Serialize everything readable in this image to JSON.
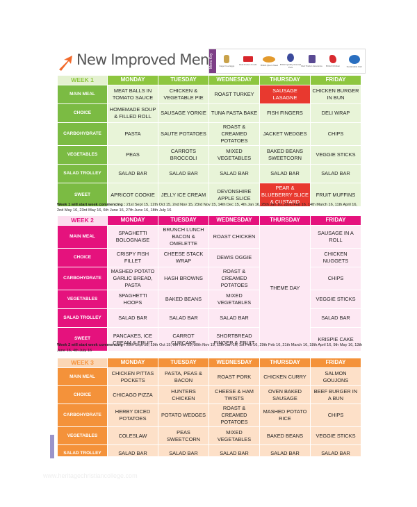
{
  "header": {
    "title": "New Improved Menus",
    "logo_tab": "Menu Key",
    "logos": [
      {
        "name": "Cage Free Eggs",
        "color": "#c9a24a"
      },
      {
        "name": "Real Frozen Foods",
        "color": "#d8262b"
      },
      {
        "name": "British Quorn Meat",
        "color": "#e39a2d"
      },
      {
        "name": "British Quality Assured Pork",
        "color": "#3b4a9c"
      },
      {
        "name": "Red Tractor Assurance",
        "color": "#5a4a93"
      },
      {
        "name": "British Chicken",
        "color": "#d82a2f"
      },
      {
        "name": "Sustainable Fish",
        "color": "#2a6fc0"
      }
    ]
  },
  "days": [
    "MONDAY",
    "TUESDAY",
    "WEDNESDAY",
    "THURSDAY",
    "FRIDAY"
  ],
  "weeks": [
    {
      "label": "WEEK 1",
      "rows": [
        {
          "label": "MAIN MEAL",
          "cells": [
            "MEAT BALLS IN TOMATO SAUCE",
            "CHICKEN & VEGETABLE PIE",
            "ROAST TURKEY",
            "SAUSAGE LASAGNE",
            "CHICKEN BURGER IN BUN"
          ]
        },
        {
          "label": "CHOICE",
          "cells": [
            "HOMEMADE SOUP & FILLED ROLL",
            "SAUSAGE YORKIE",
            "TUNA PASTA BAKE",
            "FISH FINGERS",
            "DELI WRAP"
          ]
        },
        {
          "label": "CARBOHYDRATE",
          "cells": [
            "PASTA",
            "SAUTE POTATOES",
            "ROAST & CREAMED POTATOES",
            "JACKET WEDGES",
            "CHIPS"
          ]
        },
        {
          "label": "VEGETABLES",
          "cells": [
            "PEAS",
            "CARROTS BROCCOLI",
            "MIXED VEGETABLES",
            "BAKED BEANS SWEETCORN",
            "VEGGIE STICKS"
          ]
        },
        {
          "label": "SALAD TROLLEY",
          "cells": [
            "SALAD BAR",
            "SALAD BAR",
            "SALAD BAR",
            "SALAD BAR",
            "SALAD BAR"
          ]
        },
        {
          "label": "SWEET",
          "cells": [
            "APRICOT COOKIE",
            "JELLY ICE CREAM",
            "DEVONSHIRE APPLE SLICE",
            "PEAR & BLUEBERRY SLICE & CUSTARD",
            "FRUIT MUFFINS"
          ]
        }
      ],
      "note_label": "Week 1 will start week commencing :",
      "note_dates": "21st Sept 15, 12th Oct 15, 2nd Nov 15, 23rd Nov 15, 14th Dec 15, 4th Jan 16, 25th Jan 16, 22nd Feb 16, 14th March 16, 11th April 16, 2nd May 16, 23rd May 16, 6th June 16, 27th June 16, 18th July 16"
    },
    {
      "label": "WEEK 2",
      "rows": [
        {
          "label": "MAIN MEAL",
          "cells": [
            "SPAGHETTI BOLOGNAISE",
            "BRUNCH LUNCH BACON & OMELETTE",
            "ROAST CHICKEN",
            "",
            "SAUSAGE IN A ROLL"
          ]
        },
        {
          "label": "CHOICE",
          "cells": [
            "CRISPY FISH FILLET",
            "CHEESE STACK WRAP",
            "DEWIS OGGIE",
            "",
            "CHICKEN NUGGETS"
          ]
        },
        {
          "label": "CARBOHYDRATE",
          "cells": [
            "MASHED POTATO GARLIC BREAD, PASTA",
            "HASH BROWNS",
            "ROAST & CREAMED POTATOES",
            "",
            "CHIPS"
          ]
        },
        {
          "label": "VEGETABLES",
          "cells": [
            "SPAGHETTI HOOPS",
            "BAKED BEANS",
            "MIXED VEGETABLES",
            "THEME DAY",
            "VEGGIE STICKS"
          ]
        },
        {
          "label": "SALAD TROLLEY",
          "cells": [
            "SALAD BAR",
            "SALAD BAR",
            "SALAD BAR",
            "",
            "SALAD BAR"
          ]
        },
        {
          "label": "SWEET",
          "cells": [
            "PANCAKES, ICE CREAM & FRUIT",
            "CARROT CUPCAKE",
            "SHORTBREAD FINGER & FRUIT",
            "",
            "KRISPIE CAKE"
          ]
        }
      ],
      "note_label": "Week 2 will start week commencing :",
      "note_dates": "28th Sept 15, 19th Oct 15, 9th Nov 15, 30th Nov 15, 11th Jan 16, 1st Feb 16, 29th Feb 16, 21th March 16, 18th April 16, 9th May 16, 13th June 16, 4th July 16"
    },
    {
      "label": "WEEK 3",
      "rows": [
        {
          "label": "MAIN MEAL",
          "cells": [
            "CHICKEN PITTAS POCKETS",
            "PASTA, PEAS & BACON",
            "ROAST PORK",
            "CHICKEN CURRY",
            "SALMON GOUJONS"
          ]
        },
        {
          "label": "CHOICE",
          "cells": [
            "CHICAGO PIZZA",
            "HUNTERS CHICKEN",
            "CHEESE & HAM TWISTS",
            "OVEN BAKED SAUSAGE",
            "BEEF BURGER IN A BUN"
          ]
        },
        {
          "label": "CARBOHYDRATE",
          "cells": [
            "HERBY DICED POTATOES",
            "POTATO WEDGES",
            "ROAST & CREAMED POTATOES",
            "MASHED POTATO RICE",
            "CHIPS"
          ]
        },
        {
          "label": "VEGETABLES",
          "cells": [
            "COLESLAW",
            "PEAS SWEETCORN",
            "MIXED VEGETABLES",
            "BAKED BEANS",
            "VEGGIE STICKS"
          ]
        },
        {
          "label": "SALAD TROLLEY",
          "cells": [
            "SALAD BAR",
            "SALAD BAR",
            "SALAD BAR",
            "SALAD BAR",
            "SALAD BAR"
          ]
        }
      ]
    }
  ],
  "highlights": {
    "color": "#e8392f"
  },
  "watermark": "www.heritagechristiancollege.com"
}
